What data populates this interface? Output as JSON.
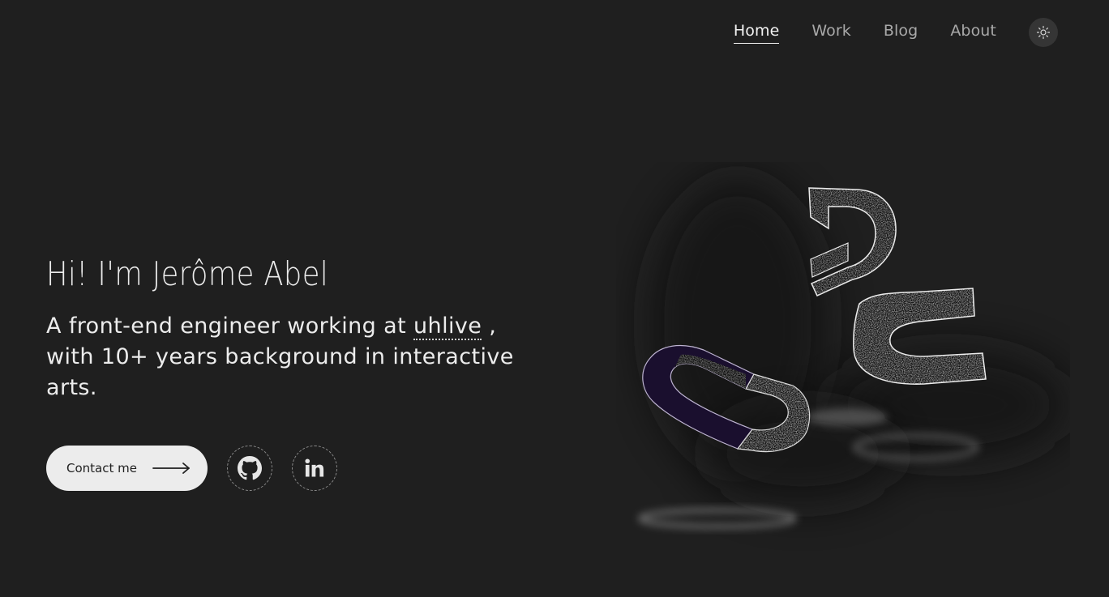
{
  "nav": {
    "items": [
      {
        "label": "Home",
        "active": true
      },
      {
        "label": "Work",
        "active": false
      },
      {
        "label": "Blog",
        "active": false
      },
      {
        "label": "About",
        "active": false
      }
    ],
    "theme_toggle_icon": "sun-icon"
  },
  "hero": {
    "title": "Hi! I'm Jerôme Abel",
    "subtitle_prefix": "A front-end engineer working at ",
    "company": "uhlive",
    "subtitle_suffix": " , with 10+ years background in interactive arts."
  },
  "actions": {
    "contact_label": "Contact me",
    "contact_icon": "arrow-right-icon",
    "github_icon": "github-icon",
    "linkedin_icon": "linkedin-icon"
  },
  "colors": {
    "background": "#1f1f1f",
    "text": "#ececec",
    "muted_nav": "#a9a9a9",
    "button_bg": "#ececec",
    "magnet_purple": "#1a0f2e"
  }
}
